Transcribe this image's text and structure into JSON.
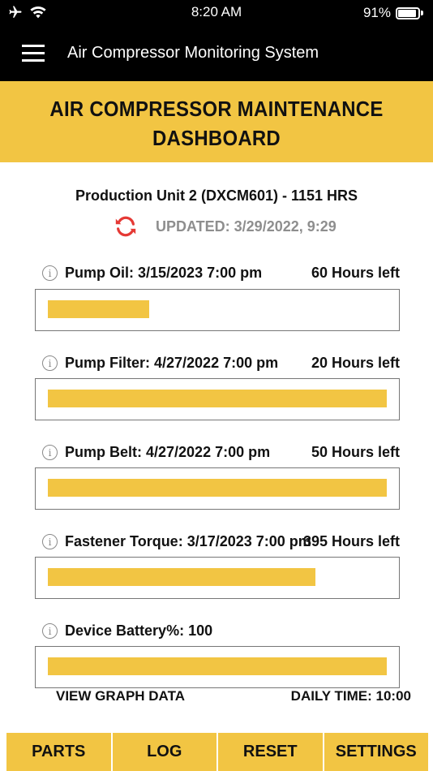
{
  "status_bar": {
    "time": "8:20 AM",
    "battery_percent": "91%",
    "battery_level": 0.91,
    "icons": [
      "airplane-icon",
      "wifi-icon",
      "battery-icon"
    ]
  },
  "app_bar": {
    "title": "Air Compressor Monitoring System",
    "menu_icon": "hamburger-menu-icon"
  },
  "banner": {
    "title": "AIR COMPRESSOR MAINTENANCE DASHBOARD"
  },
  "unit": {
    "name": "Production Unit 2 (DXCM601) - 1151 HRS",
    "updated": "UPDATED: 3/29/2022, 9:29",
    "refresh_icon": "refresh-icon"
  },
  "items": [
    {
      "label": "Pump Oil: 3/15/2023 7:00 pm",
      "hours": "60 Hours left",
      "fill_fraction": 0.3
    },
    {
      "label": "Pump Filter: 4/27/2022 7:00 pm",
      "hours": "20 Hours left",
      "fill_fraction": 1.0
    },
    {
      "label": "Pump Belt: 4/27/2022 7:00 pm",
      "hours": "50 Hours left",
      "fill_fraction": 1.0
    },
    {
      "label": "Fastener Torque: 3/17/2023 7:00 pm",
      "hours": "395 Hours left",
      "fill_fraction": 0.79
    },
    {
      "label": "Device Battery%: 100",
      "hours": "",
      "fill_fraction": 1.0
    }
  ],
  "footer": {
    "graph_link": "VIEW GRAPH DATA",
    "daily_time": "DAILY TIME: 10:00"
  },
  "colors": {
    "accent": "#f2c543",
    "refresh": "#e53935",
    "muted": "#8e8e8e"
  },
  "bottom_nav": [
    "PARTS",
    "LOG",
    "RESET",
    "SETTINGS"
  ]
}
